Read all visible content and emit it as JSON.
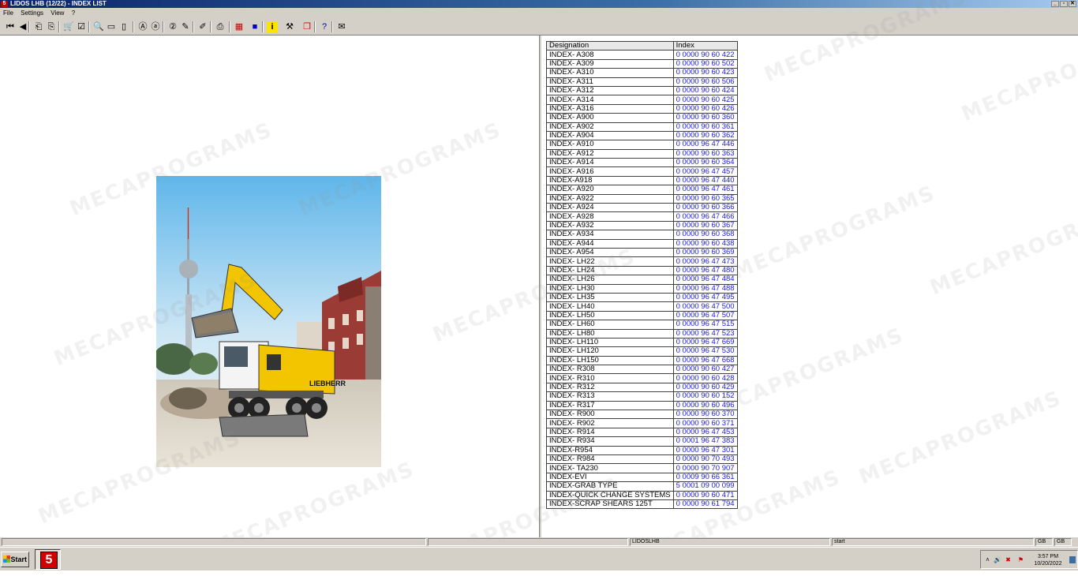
{
  "window": {
    "title": "LIDOS LHB (12/22) - INDEX LIST",
    "app_icon": "lidos-app-icon",
    "controls": [
      "_",
      "▫",
      "✕"
    ]
  },
  "menu": {
    "items": [
      "File",
      "Settings",
      "View",
      "?"
    ]
  },
  "toolbar": {
    "buttons": [
      {
        "name": "first-page-icon",
        "glyph": "⏮"
      },
      {
        "name": "previous-icon",
        "glyph": "◀"
      },
      {
        "name": "back-icon",
        "glyph": "⎗"
      },
      {
        "name": "forward-icon",
        "glyph": "⎘"
      },
      {
        "name": "cart-icon",
        "glyph": "🛒"
      },
      {
        "name": "checklist-icon",
        "glyph": "☑"
      },
      {
        "name": "zoom-icon",
        "glyph": "🔍"
      },
      {
        "name": "page-icon",
        "glyph": "▭"
      },
      {
        "name": "pages-icon",
        "glyph": "▯"
      },
      {
        "name": "search-a-icon",
        "glyph": "Ⓐ"
      },
      {
        "name": "search-a-next-icon",
        "glyph": "ⓐ"
      },
      {
        "name": "search-2-icon",
        "glyph": "②"
      },
      {
        "name": "search-2-next-icon",
        "glyph": "✎"
      },
      {
        "name": "edit-icon",
        "glyph": "✐"
      },
      {
        "name": "print-icon",
        "glyph": "⎙"
      },
      {
        "name": "grid-icon",
        "glyph": "▦"
      },
      {
        "name": "color-icon",
        "glyph": "■"
      },
      {
        "name": "info-icon",
        "glyph": "i"
      },
      {
        "name": "tool-icon",
        "glyph": "⚒"
      },
      {
        "name": "book-icon",
        "glyph": "❐"
      },
      {
        "name": "help-icon",
        "glyph": "?"
      },
      {
        "name": "mail-icon",
        "glyph": "✉"
      }
    ]
  },
  "index_table": {
    "headers": {
      "designation": "Designation",
      "index": "Index"
    },
    "rows": [
      [
        "INDEX- A308",
        "0 0000 90 60 422"
      ],
      [
        "INDEX- A309",
        "0 0000 90 60 502"
      ],
      [
        "INDEX- A310",
        "0 0000 90 60 423"
      ],
      [
        "INDEX- A311",
        "0 0000 90 60 506"
      ],
      [
        "INDEX- A312",
        "0 0000 90 60 424"
      ],
      [
        "INDEX- A314",
        "0 0000 90 60 425"
      ],
      [
        "INDEX- A316",
        "0 0000 90 60 426"
      ],
      [
        "INDEX- A900",
        "0 0000 90 60 360"
      ],
      [
        "INDEX- A902",
        "0 0000 90 60 361"
      ],
      [
        "INDEX- A904",
        "0 0000 90 60 362"
      ],
      [
        "INDEX- A910",
        "0 0000 96 47 446"
      ],
      [
        "INDEX- A912",
        "0 0000 90 60 363"
      ],
      [
        "INDEX- A914",
        "0 0000 90 60 364"
      ],
      [
        "INDEX- A916",
        "0 0000 96 47 457"
      ],
      [
        "INDEX-A918",
        "0 0000 96 47 440"
      ],
      [
        "INDEX- A920",
        "0 0000 96 47 461"
      ],
      [
        "INDEX- A922",
        "0 0000 90 60 365"
      ],
      [
        "INDEX- A924",
        "0 0000 90 60 366"
      ],
      [
        "INDEX- A928",
        "0 0000 96 47 466"
      ],
      [
        "INDEX- A932",
        "0 0000 90 60 367"
      ],
      [
        "INDEX- A934",
        "0 0000 90 60 368"
      ],
      [
        "INDEX- A944",
        "0 0000 90 60 438"
      ],
      [
        "INDEX- A954",
        "0 0000 90 60 369"
      ],
      [
        "INDEX- LH22",
        "0 0000 96 47 473"
      ],
      [
        "INDEX- LH24",
        "0 0000 96 47 480"
      ],
      [
        "INDEX- LH26",
        "0 0000 96 47 484"
      ],
      [
        "INDEX- LH30",
        "0 0000 96 47 488"
      ],
      [
        "INDEX- LH35",
        "0 0000 96 47 495"
      ],
      [
        "INDEX- LH40",
        "0 0000 96 47 500"
      ],
      [
        "INDEX- LH50",
        "0 0000 96 47 507"
      ],
      [
        "INDEX- LH60",
        "0 0000 96 47 515"
      ],
      [
        "INDEX- LH80",
        "0 0000 96 47 523"
      ],
      [
        "INDEX- LH110",
        "0 0000 96 47 669"
      ],
      [
        "INDEX- LH120",
        "0 0000 96 47 530"
      ],
      [
        "INDEX- LH150",
        "0 0000 96 47 668"
      ],
      [
        "INDEX- R308",
        "0 0000 90 60 427"
      ],
      [
        "INDEX- R310",
        "0 0000 90 60 428"
      ],
      [
        "INDEX- R312",
        "0 0000 90 60 429"
      ],
      [
        "INDEX- R313",
        "0 0000 90 60 152"
      ],
      [
        "INDEX- R317",
        "0 0000 90 60 496"
      ],
      [
        "INDEX- R900",
        "0 0000 90 60 370"
      ],
      [
        "INDEX- R902",
        "0 0000 90 60 371"
      ],
      [
        "INDEX- R914",
        "0 0000 96 47 453"
      ],
      [
        "INDEX- R934",
        "0 0001 96 47 383"
      ],
      [
        "INDEX-R954",
        "0 0000 96 47 301"
      ],
      [
        "INDEX- R984",
        "0 0000 90 70 493"
      ],
      [
        "INDEX- TA230",
        "0 0000 90 70 907"
      ],
      [
        "INDEX-EVI",
        "0 0009 90 66 361"
      ],
      [
        "INDEX-GRAB TYPE",
        "5 0001 09 00 099"
      ],
      [
        "INDEX-QUICK CHANGE SYSTEMS",
        "0 0000 90 60 471"
      ],
      [
        "INDEX-SCRAP SHEARS 125T",
        "0 0000 90 61 794"
      ]
    ]
  },
  "image": {
    "alt": "Liebherr wheeled excavator in front of TV tower",
    "brand_text": "LIEBHERR"
  },
  "statusbar": {
    "module": "LIDOSLHB",
    "status": "start",
    "lang1": "GB",
    "lang2": "GB"
  },
  "taskbar": {
    "start_label": "Start",
    "time": "3:57 PM",
    "date": "10/20/2022"
  },
  "watermark": "MECAPROGRAMS",
  "colors": {
    "title_bar": "#0a246a",
    "link": "#1a1ad8",
    "chrome": "#d4d0c8"
  }
}
